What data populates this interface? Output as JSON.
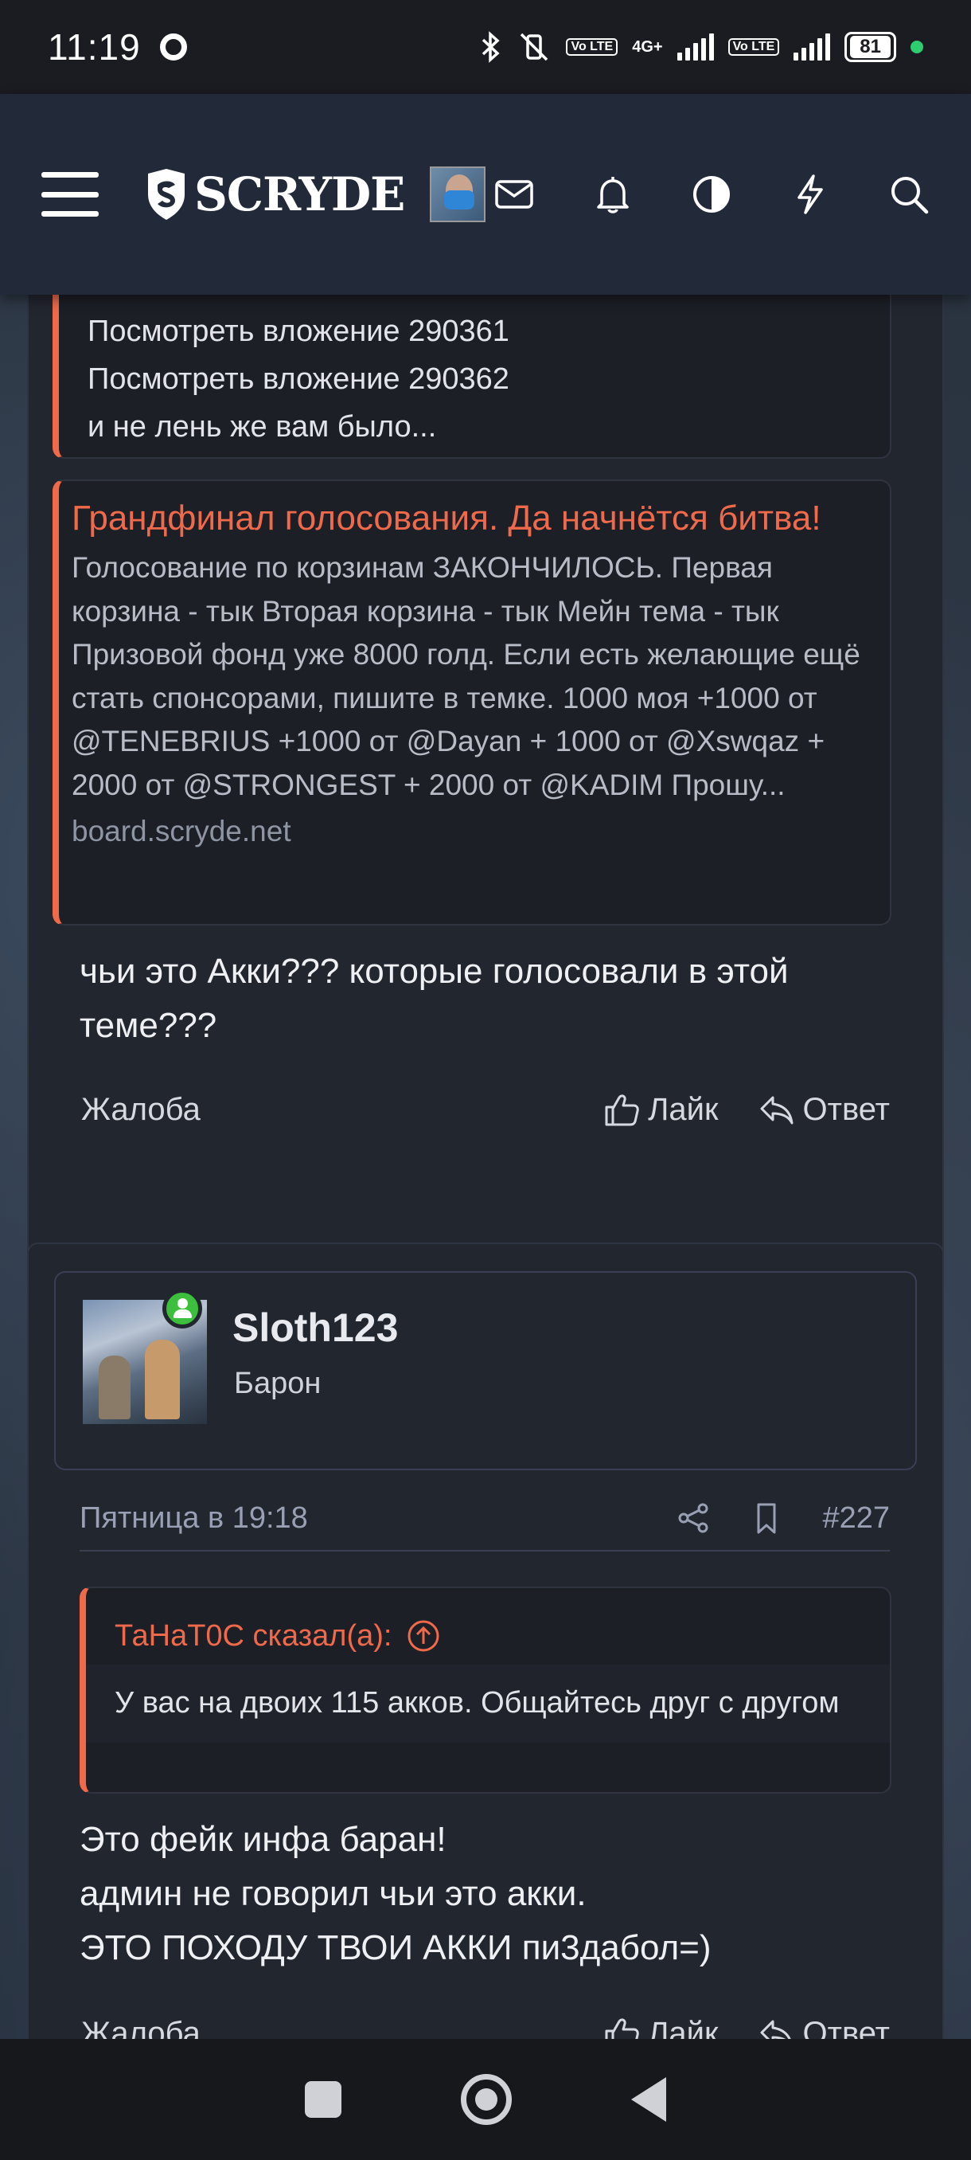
{
  "status_bar": {
    "time": "11:19",
    "network": "4G+",
    "volte_label": "Vo LTE",
    "battery": "81"
  },
  "header": {
    "logo_text": "SCRYDE",
    "icons": [
      "menu-icon",
      "mail-icon",
      "bell-icon",
      "contrast-icon",
      "lightning-icon",
      "search-icon"
    ]
  },
  "post1": {
    "quote_lines": [
      "Посмотреть вложение 290361",
      "Посмотреть вложение 290362",
      "и не лень же вам было..."
    ],
    "unfurl": {
      "title": "Грандфинал голосования. Да начнётся битва!",
      "description": "Голосование по корзинам ЗАКОНЧИЛОСЬ. Первая корзина - тык Вторая корзина - тык Мейн тема - тык Призовой фонд уже 8000 голд. Если есть желающие ещё стать спонсорами, пишите в темке. 1000 моя +1000 от @TENEBRIUS +1000 от @Dayan + 1000 от @Xswqaz + 2000 от @STRONGEST + 2000 от @KADIM Прошу...",
      "host": "board.scryde.net"
    },
    "body": "чьи это Акки??? которые голосовали в этой теме???",
    "actions": {
      "report": "Жалоба",
      "like": "Лайк",
      "reply": "Ответ"
    }
  },
  "post2": {
    "username": "Sloth123",
    "user_title": "Барон",
    "date": "Пятница в 19:18",
    "post_number": "#227",
    "quote_author": "ТаНаТ0С сказал(а):",
    "quote_text": "У вас на двоих 115 акков. Общайтесь друг с другом",
    "body_lines": [
      "Это фейк инфа баран!",
      "админ не говорил чьи это акки.",
      "ЭТО ПОХОДУ ТВОИ АККИ пи3дабол=)"
    ],
    "actions": {
      "report": "Жалоба",
      "like": "Лайк",
      "reply": "Ответ"
    }
  },
  "colors": {
    "accent": "#f0694a",
    "header_bg": "#222a3a",
    "card_bg": "#22262f",
    "online": "#3cbf3c"
  }
}
